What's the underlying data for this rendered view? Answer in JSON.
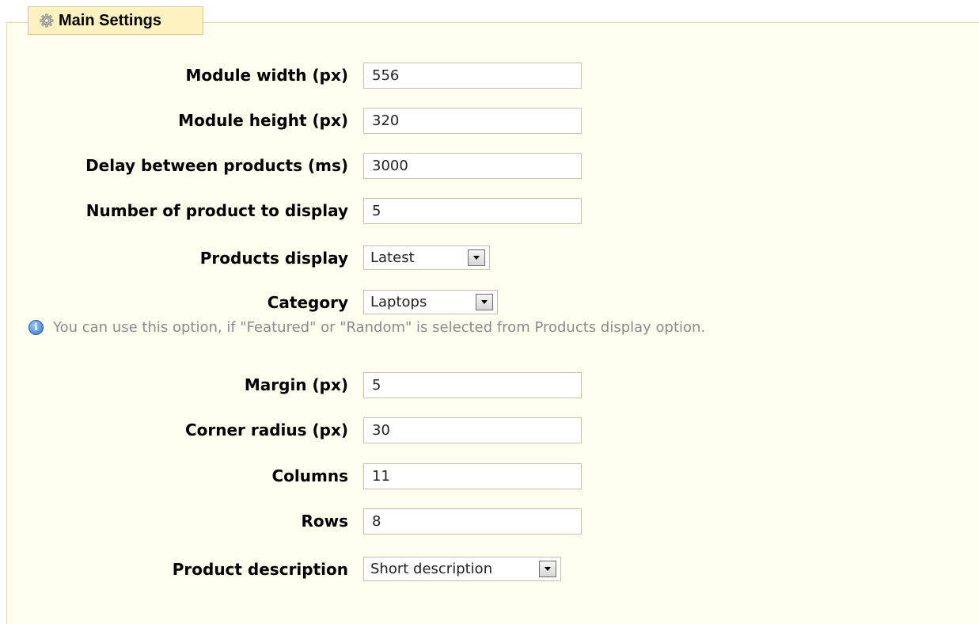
{
  "section": {
    "title": "Main Settings",
    "icon": "gear-icon"
  },
  "fields": {
    "module_width": {
      "label": "Module width (px)",
      "value": "556"
    },
    "module_height": {
      "label": "Module height (px)",
      "value": "320"
    },
    "delay": {
      "label": "Delay between products (ms)",
      "value": "3000"
    },
    "num_products": {
      "label": "Number of product to display",
      "value": "5"
    },
    "products_display": {
      "label": "Products display",
      "selected": "Latest"
    },
    "category": {
      "label": "Category",
      "selected": "Laptops"
    },
    "category_hint": "You can use this option, if \"Featured\" or \"Random\" is selected from Products display option.",
    "margin": {
      "label": "Margin (px)",
      "value": "5"
    },
    "corner_radius": {
      "label": "Corner radius (px)",
      "value": "30"
    },
    "columns": {
      "label": "Columns",
      "value": "11"
    },
    "rows": {
      "label": "Rows",
      "value": "8"
    },
    "product_description": {
      "label": "Product description",
      "selected": "Short description"
    }
  },
  "colors": {
    "panel_background": "#fffff0",
    "legend_background": "#fff1c0",
    "hint_text": "#8a8a8a",
    "info_icon": "#3476c4"
  }
}
